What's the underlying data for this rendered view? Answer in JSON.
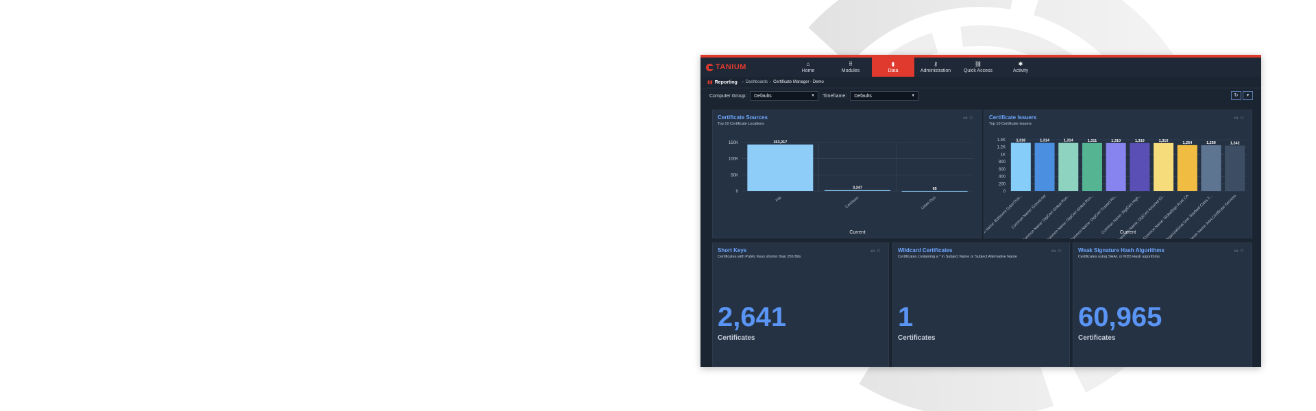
{
  "nav": {
    "brand": "TANIUM",
    "items": [
      {
        "label": "Home",
        "icon": "home-icon",
        "glyph": "⌂"
      },
      {
        "label": "Modules",
        "icon": "grid-icon",
        "glyph": "⠿"
      },
      {
        "label": "Data",
        "icon": "bar-chart-icon",
        "glyph": "▮"
      },
      {
        "label": "Administration",
        "icon": "key-icon",
        "glyph": "⚷"
      },
      {
        "label": "Quick Access",
        "icon": "link-icon",
        "glyph": "⛓"
      },
      {
        "label": "Activity",
        "icon": "bell-icon",
        "glyph": "✱"
      }
    ],
    "active": "Data"
  },
  "breadcrumb": {
    "section": "Reporting",
    "items": [
      "Dashboards",
      "Certificate Manager - Demo"
    ]
  },
  "filters": {
    "computer_group_label": "Computer Group:",
    "computer_group_value": "Defaults",
    "timeframe_label": "Timeframe:",
    "timeframe_value": "Defaults"
  },
  "panels": {
    "sources": {
      "title": "Certificate Sources",
      "subtitle": "Top 10 Certificate Locations"
    },
    "issuers": {
      "title": "Certificate Issuers",
      "subtitle": "Top 10 Certificate Issuers"
    },
    "short_keys": {
      "title": "Short Keys",
      "subtitle": "Certificates with Public Keys shorter than 256 Bits",
      "value": "2,641",
      "unit": "Certificates"
    },
    "wildcard": {
      "title": "Wildcard Certificates",
      "subtitle": "Certificates containing a * in Subject Name or Subject Alternative Name",
      "value": "1",
      "unit": "Certificates"
    },
    "weak_sig": {
      "title": "Weak Signature Hash Algorithms",
      "subtitle": "Certificates using SHA1 or MD5 Hash algorithms",
      "value": "60,965",
      "unit": "Certificates"
    }
  },
  "chart_data": [
    {
      "type": "bar",
      "title": "Certificate Sources",
      "categories": [
        "File",
        "CertStore",
        "Listen Port"
      ],
      "values": [
        153217,
        3247,
        65
      ],
      "data_labels": [
        "153,217",
        "3,247",
        "65"
      ],
      "yticks": [
        "0",
        "50K",
        "100K",
        "150K"
      ],
      "ylim": [
        0,
        160000
      ],
      "xlabel": "Current",
      "colors": [
        "#8dcdf8"
      ],
      "grid": true
    },
    {
      "type": "bar",
      "title": "Certificate Issuers",
      "categories": [
        "Common Name: Baltimore CyberTrus...",
        "Common Name: Entrust.net",
        "Common Name: DigiCert Global Roo...",
        "Common Name: DigiCert Global Roo...",
        "Common Name: DigiCert Trusted Ro...",
        "Common Name: DigiCert High...",
        "Common Name: DigiCert Assured ID...",
        "Common Name: GlobalSign Root CA",
        "Organizational Unit: Starfield Class 2...",
        "Common Name: AAA Certificate Services"
      ],
      "values": [
        1316,
        1314,
        1314,
        1311,
        1310,
        1310,
        1310,
        1254,
        1250,
        1242
      ],
      "data_labels": [
        "1,316",
        "1,314",
        "1,314",
        "1,311",
        "1,310",
        "1,310",
        "1,310",
        "1,254",
        "1,250",
        "1,242"
      ],
      "yticks": [
        "0",
        "200",
        "400",
        "600",
        "800",
        "1K",
        "1.2K",
        "1.4K"
      ],
      "ylim": [
        0,
        1400
      ],
      "xlabel": "Current",
      "colors": [
        "#86cdf9",
        "#4a8fe0",
        "#8ed3bf",
        "#55b592",
        "#8884ef",
        "#5a4fb5",
        "#f6dc7b",
        "#f0bd42",
        "#5e7592",
        "#3d4d63"
      ],
      "grid": true
    }
  ]
}
